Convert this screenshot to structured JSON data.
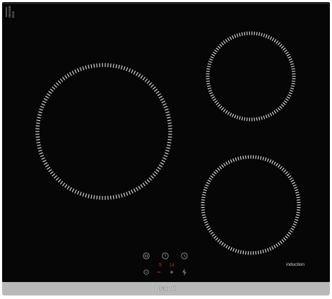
{
  "cooktop": {
    "brand": "Brandt",
    "model_label": "induction",
    "sensor_label_lines": [
      "SENSOR",
      "ECI6"
    ],
    "colors": {
      "glass": "#060606",
      "frame": "#b9b9b9",
      "zone_marks": "#e8e8e8",
      "control_outline": "#8a8a8a",
      "display_red": "#d6252b"
    },
    "zones": [
      {
        "name": "large-left"
      },
      {
        "name": "small-top-right"
      },
      {
        "name": "medium-bottom-right"
      }
    ],
    "controls": {
      "top_row_icons": [
        "pause-icon",
        "power-icon",
        "timer-icon"
      ],
      "display": {
        "zone_digit": "5",
        "level_digit": "14"
      },
      "bottom_row_icons": [
        "lock-icon",
        "minus-icon",
        "plus-icon",
        "boost-icon"
      ]
    }
  }
}
